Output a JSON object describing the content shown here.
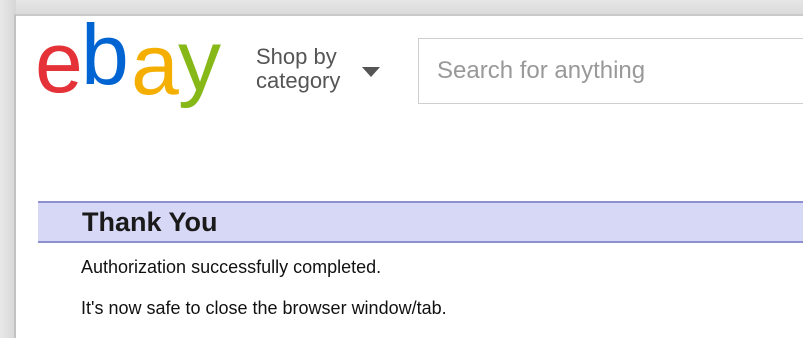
{
  "header": {
    "logo_letters": [
      {
        "char": "e",
        "color": "#e53238"
      },
      {
        "char": "b",
        "color": "#0064d2"
      },
      {
        "char": "a",
        "color": "#f5af02"
      },
      {
        "char": "y",
        "color": "#86b817"
      }
    ],
    "shop_by_label": "Shop by category",
    "search_placeholder": "Search for anything"
  },
  "main": {
    "title": "Thank You",
    "message_1": "Authorization successfully completed.",
    "message_2": "It's now safe to close the browser window/tab."
  },
  "colors": {
    "banner_bg": "#d6d8f6",
    "banner_border": "#8e8fd1"
  },
  "icons": [
    "ebay-logo",
    "chevron-down-icon"
  ]
}
